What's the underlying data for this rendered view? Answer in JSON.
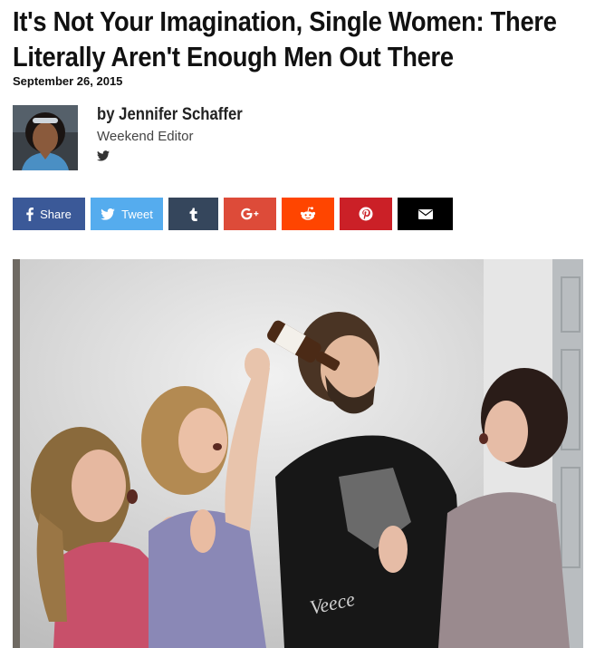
{
  "article": {
    "headline": "It's Not Your Imagination, Single Women: There Literally Aren't Enough Men Out There",
    "date": "September 26, 2015"
  },
  "author": {
    "name": "by Jennifer Schaffer",
    "role": "Weekend Editor"
  },
  "share": {
    "facebook_label": "Share",
    "twitter_label": "Tweet",
    "colors": {
      "facebook": "#3b5998",
      "twitter": "#55acee",
      "tumblr": "#35465c",
      "googleplus": "#dd4b39",
      "reddit": "#ff4500",
      "pinterest": "#cb2027",
      "email": "#000000"
    }
  },
  "photo": {
    "shirt_text": "Veece"
  }
}
